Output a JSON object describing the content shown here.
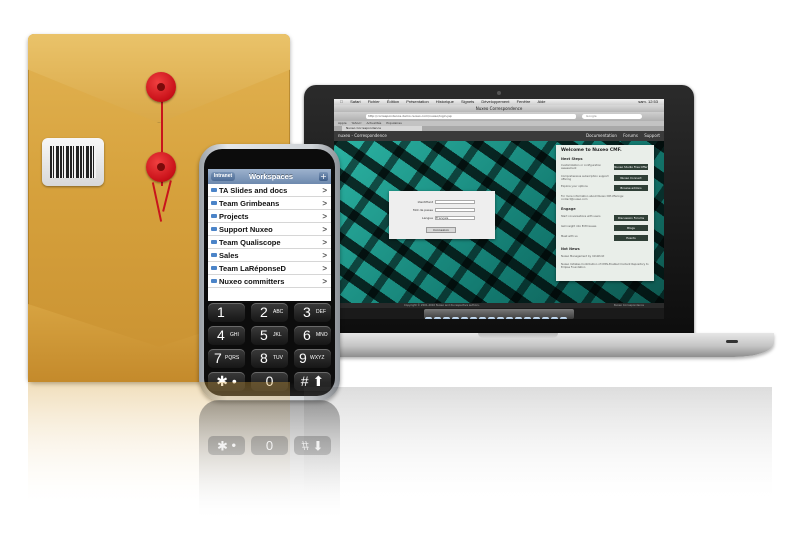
{
  "mac_menu": {
    "apple": "",
    "items": [
      "Safari",
      "Fichier",
      "Édition",
      "Présentation",
      "Historique",
      "Signets",
      "Développement",
      "Fenêtre",
      "Aide"
    ],
    "clock": "sam. 12:53"
  },
  "browser": {
    "title": "Nuxeo Correspondence",
    "url": "http://correspondence.demo.nuxeo.com/nuxeo/login.jsp",
    "search_placeholder": "Google",
    "bookmarks": [
      "Apple",
      "Yahoo!",
      "Actualités",
      "Populaires"
    ],
    "tab": "Nuxeo Correspondence"
  },
  "webapp": {
    "brand": "nuxeo - Correspondence",
    "nav": [
      "Documentation",
      "Forums",
      "Support"
    ],
    "login": {
      "username_label": "Identifiant",
      "password_label": "Mot de passe",
      "language_label": "Langue",
      "language_value": "Français",
      "submit_label": "Connexion"
    },
    "panel": {
      "title": "Welcome to Nuxeo CMF.",
      "next_steps": "Next Steps",
      "t1": "Customization or configuration assessment",
      "b1": "Nuxeo Studio Free Offer",
      "t2": "Comprehensive subscription support offering",
      "b2": "Nuxeo Connect",
      "t3": "Explore your options",
      "b3": "Browse addons",
      "t4": "For more information about Nuxeo DM offerings: contact@nuxeo.com",
      "engage": "Engage",
      "t5": "Start conversations with users",
      "b5": "Discussion Forums",
      "t6": "Get insight into ECM issues",
      "b6": "Blogs",
      "t7": "Meet with us",
      "b7": "Events",
      "news": "Nxt News",
      "n1": "Nuxeo Management by InfoWorld",
      "n2": "Nuxeo Initiates Contribution of CMIS-Enabled Content Repository to Eclipse Foundation"
    },
    "footer_left": "Copyright © 2001-2010 Nuxeo and its respective authors.",
    "footer_right": "Nuxeo Correspondence"
  },
  "phone": {
    "back_label": "Intranet",
    "title": "Workspaces",
    "add_label": "+",
    "rows": [
      "TA Slides and docs",
      "Team Grimbeans",
      "Projects",
      "Support Nuxeo",
      "Team Qualiscope",
      "Sales",
      "Team LaRéponseD",
      "Nuxeo committers"
    ],
    "chevron": ">",
    "keys": [
      {
        "n": "1",
        "l": ""
      },
      {
        "n": "2",
        "l": "ABC"
      },
      {
        "n": "3",
        "l": "DEF"
      },
      {
        "n": "4",
        "l": "GHI"
      },
      {
        "n": "5",
        "l": "JKL"
      },
      {
        "n": "6",
        "l": "MNO"
      },
      {
        "n": "7",
        "l": "PQRS"
      },
      {
        "n": "8",
        "l": "TUV"
      },
      {
        "n": "9",
        "l": "WXYZ"
      },
      {
        "n": "✱ •",
        "l": ""
      },
      {
        "n": "0",
        "l": ""
      },
      {
        "n": "# ⬆",
        "l": ""
      }
    ]
  },
  "reflection_keys": [
    "✱ •",
    "0",
    "# ⬆"
  ],
  "colors": {
    "envelope": "#d6a13c",
    "button_red": "#c81018",
    "hero_teal": "#2bb3a3",
    "phone_nav": "#6d89ae"
  }
}
